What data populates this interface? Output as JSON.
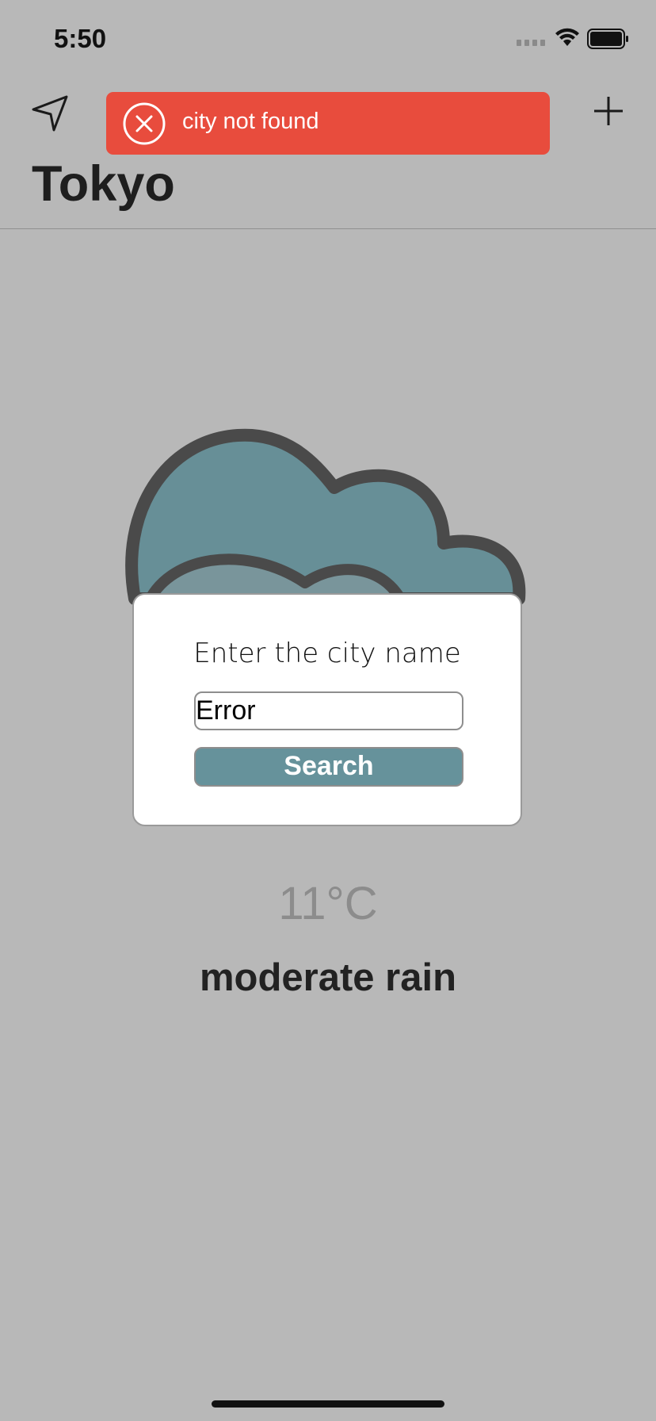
{
  "status_bar": {
    "time": "5:50",
    "icons": [
      "cellular-signal-icon",
      "wifi-icon",
      "battery-icon"
    ]
  },
  "nav": {
    "left_icon": "location-arrow-icon",
    "right_icon": "plus-icon"
  },
  "toast": {
    "message": "city not found",
    "icon": "error-x-icon",
    "color": "#e84c3d"
  },
  "city": {
    "name": "Tokyo"
  },
  "weather": {
    "icon": "rain-cloud-icon",
    "temperature": "11°C",
    "condition": "moderate rain"
  },
  "dialog": {
    "title": "Enter the city name",
    "input_value": "Error",
    "button_label": "Search",
    "button_color": "#66929b"
  }
}
